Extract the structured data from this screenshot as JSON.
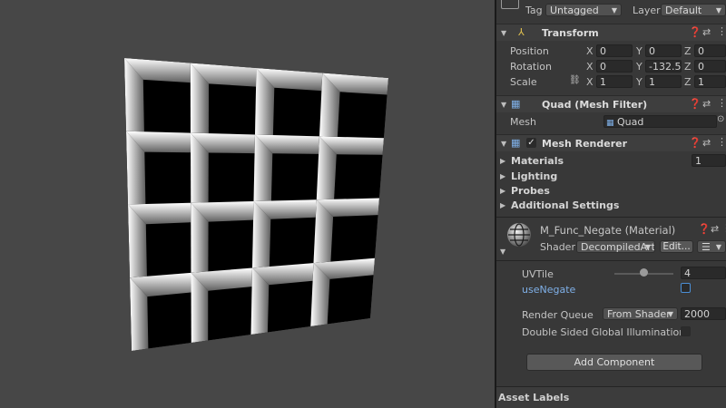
{
  "header": {
    "tag_label": "Tag",
    "tag_value": "Untagged",
    "layer_label": "Layer",
    "layer_value": "Default"
  },
  "transform": {
    "title": "Transform",
    "position_label": "Position",
    "rotation_label": "Rotation",
    "scale_label": "Scale",
    "position": {
      "x": "0",
      "y": "0",
      "z": "0"
    },
    "rotation": {
      "x": "0",
      "y": "-132.52",
      "z": "0"
    },
    "scale": {
      "x": "1",
      "y": "1",
      "z": "1"
    }
  },
  "mesh_filter": {
    "title": "Quad (Mesh Filter)",
    "mesh_label": "Mesh",
    "mesh_value": "Quad"
  },
  "mesh_renderer": {
    "title": "Mesh Renderer",
    "materials_label": "Materials",
    "materials_count": "1",
    "lighting_label": "Lighting",
    "probes_label": "Probes",
    "additional_label": "Additional Settings"
  },
  "material": {
    "title": "M_Func_Negate (Material)",
    "shader_label": "Shader",
    "shader_value": "DecompiledArt",
    "edit_label": "Edit...",
    "uvtile_label": "UVTile",
    "uvtile_value": "4",
    "uvtile_slider_fraction": 0.5,
    "usenegate_label": "useNegate",
    "render_queue_label": "Render Queue",
    "render_queue_mode": "From Shader",
    "render_queue_value": "2000",
    "double_sided_label": "Double Sided Global Illumination"
  },
  "add_component_label": "Add Component",
  "asset_labels": "Asset Labels",
  "colors": {
    "panel_bg": "#383838",
    "scene_bg": "#474747",
    "link_blue": "#7fb0e8",
    "checkbox_blue": "#4b8fd6"
  }
}
